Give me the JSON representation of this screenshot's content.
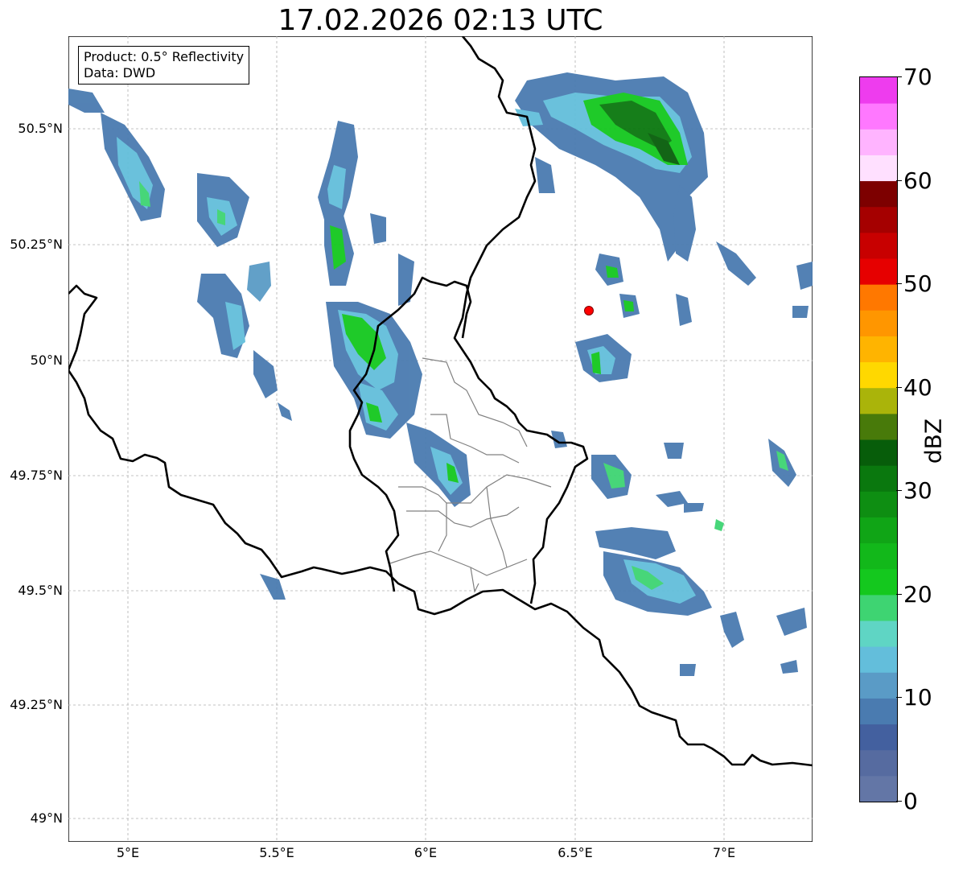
{
  "title": "17.02.2026 02:13 UTC",
  "info_box": {
    "product": "Product: 0.5° Reflectivity",
    "data": "Data: DWD"
  },
  "axes": {
    "lat_ticks": [
      "50.5°N",
      "50.25°N",
      "50°N",
      "49.75°N",
      "49.5°N",
      "49.25°N",
      "49°N"
    ],
    "lon_ticks": [
      "5°E",
      "5.5°E",
      "6°E",
      "6.5°E",
      "7°E"
    ]
  },
  "colorbar": {
    "label": "dBZ",
    "ticks": [
      "0",
      "10",
      "20",
      "30",
      "40",
      "50",
      "60",
      "70"
    ],
    "colors": [
      "#6376a6",
      "#566ba0",
      "#43609f",
      "#4a7bb0",
      "#5a9bc6",
      "#63bedb",
      "#5fd5c4",
      "#3ed472",
      "#14c81e",
      "#12b81a",
      "#10a516",
      "#0e8e12",
      "#0a780e",
      "#075d0a",
      "#487a0a",
      "#aab40a",
      "#ffd800",
      "#ffb400",
      "#ff9600",
      "#ff7800",
      "#e60000",
      "#c80000",
      "#a50000",
      "#7d0000",
      "#ffe0ff",
      "#ffb4ff",
      "#ff78ff",
      "#ee3cee"
    ]
  },
  "marker": {
    "label": "radar-site",
    "color": "#ff0000"
  }
}
